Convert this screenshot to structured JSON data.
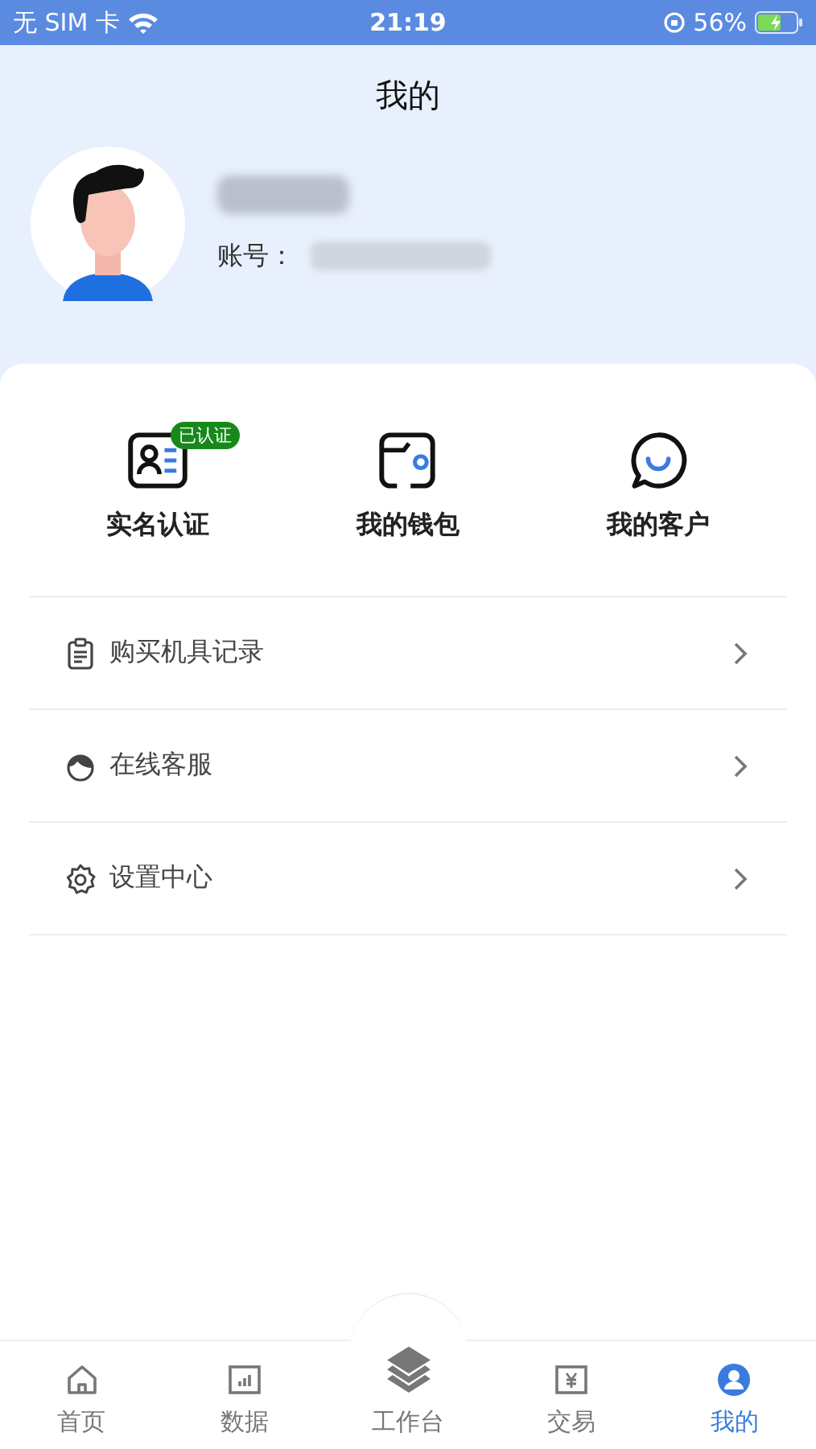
{
  "status_bar": {
    "carrier": "无 SIM 卡",
    "time": "21:19",
    "battery": "56%"
  },
  "header": {
    "title": "我的",
    "account_label": "账号："
  },
  "quick_actions": [
    {
      "label": "实名认证",
      "badge": "已认证"
    },
    {
      "label": "我的钱包"
    },
    {
      "label": "我的客户"
    }
  ],
  "menu": [
    {
      "label": "购买机具记录"
    },
    {
      "label": "在线客服"
    },
    {
      "label": "设置中心"
    }
  ],
  "tab_bar": [
    {
      "label": "首页",
      "selected": false
    },
    {
      "label": "数据",
      "selected": false
    },
    {
      "label": "工作台",
      "selected": false,
      "kind": "center"
    },
    {
      "label": "交易",
      "selected": false
    },
    {
      "label": "我的",
      "selected": true
    }
  ]
}
